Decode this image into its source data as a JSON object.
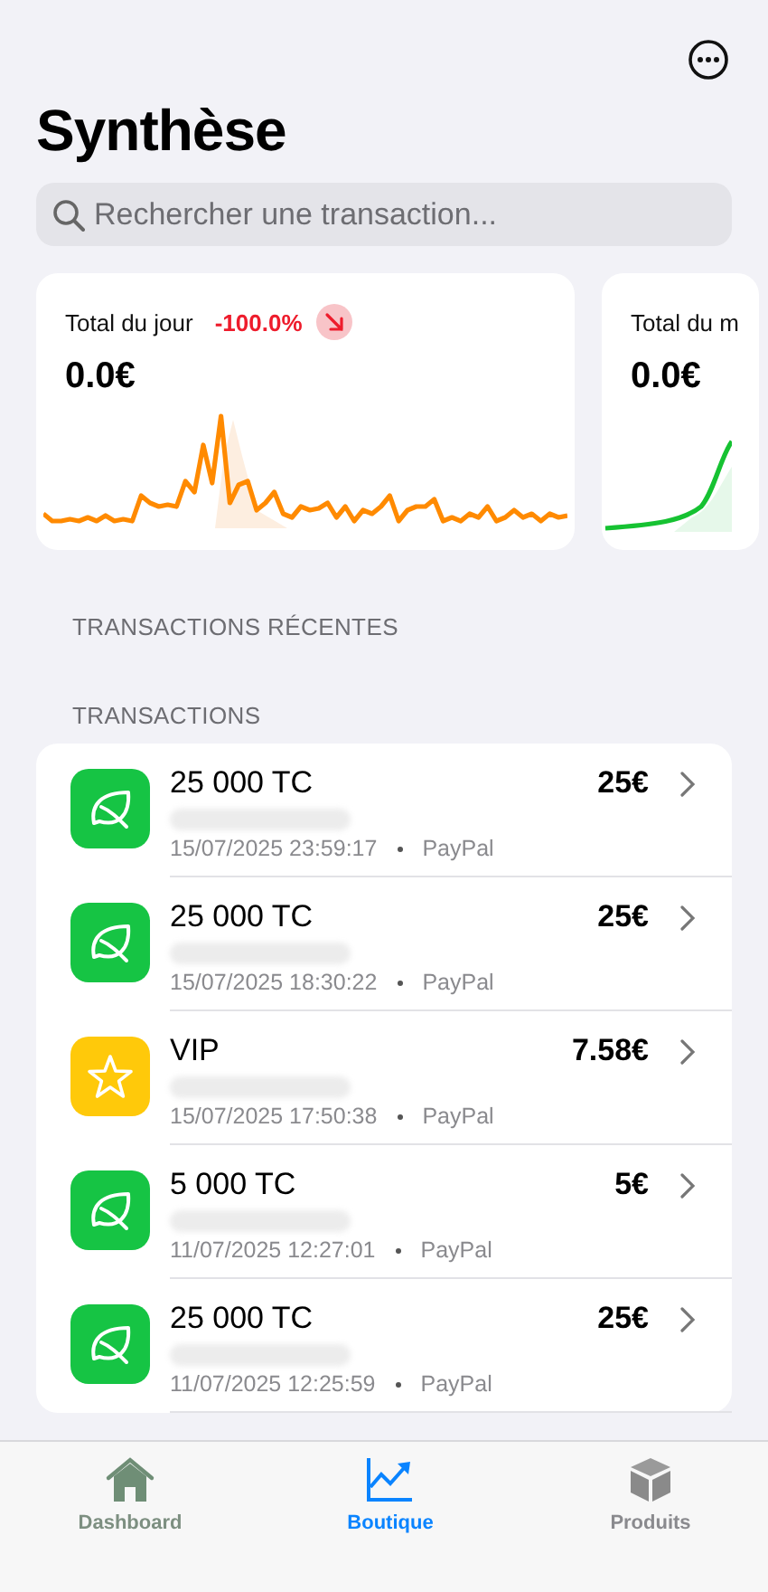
{
  "title": "Synthèse",
  "search": {
    "placeholder": "Rechercher une transaction..."
  },
  "summary_cards": [
    {
      "label": "Total du jour",
      "change": "-100.0%",
      "value": "0.0€",
      "kind": "falling"
    },
    {
      "label": "Total du m",
      "value": "0.0€",
      "kind": "plain"
    }
  ],
  "sections": [
    {
      "heading": "TRANSACTIONS RÉCENTES"
    },
    {
      "heading": "TRANSACTIONS"
    }
  ],
  "transactions": [
    {
      "kind": "leaf",
      "title": "25 000 TC",
      "amount": "25€",
      "date": "15/07/2025 23:59:17",
      "method": "PayPal"
    },
    {
      "kind": "leaf",
      "title": "25 000 TC",
      "amount": "25€",
      "date": "15/07/2025 18:30:22",
      "method": "PayPal"
    },
    {
      "kind": "star",
      "title": "VIP",
      "amount": "7.58€",
      "date": "15/07/2025 17:50:38",
      "method": "PayPal"
    },
    {
      "kind": "leaf",
      "title": "5 000 TC",
      "amount": "5€",
      "date": "11/07/2025 12:27:01",
      "method": "PayPal"
    },
    {
      "kind": "leaf",
      "title": "25 000 TC",
      "amount": "25€",
      "date": "11/07/2025 12:25:59",
      "method": "PayPal"
    }
  ],
  "tab_bar": [
    {
      "label": "Dashboard",
      "kind": "house",
      "selected": false
    },
    {
      "label": "Boutique",
      "kind": "chart",
      "selected": true
    },
    {
      "label": "Produits",
      "kind": "box",
      "selected": false
    }
  ]
}
